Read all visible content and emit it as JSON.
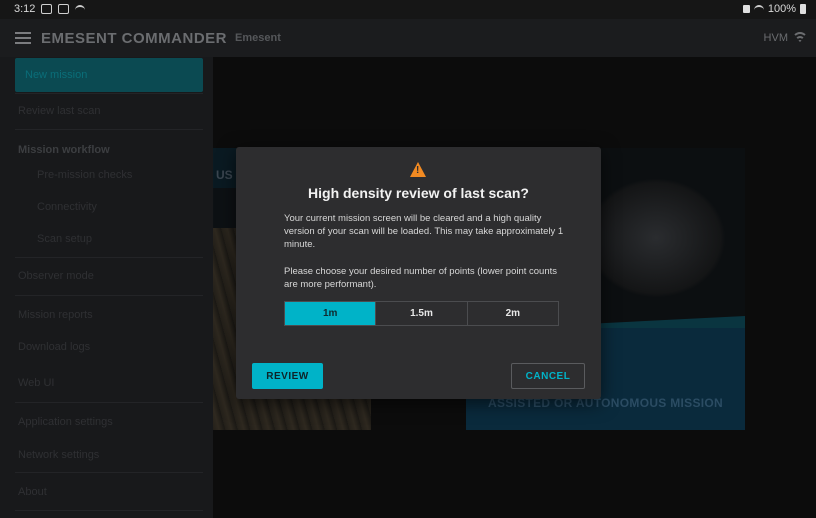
{
  "status_bar": {
    "time": "3:12",
    "battery": "100%"
  },
  "app_bar": {
    "title": "EMESENT COMMANDER",
    "subtitle": "Emesent",
    "device": "HVM"
  },
  "sidebar": {
    "items": [
      {
        "label": "New mission"
      },
      {
        "label": "Review last scan"
      },
      {
        "label": "Mission workflow"
      },
      {
        "label": "Pre-mission checks"
      },
      {
        "label": "Connectivity"
      },
      {
        "label": "Scan setup"
      },
      {
        "label": "Observer mode"
      },
      {
        "label": "Mission reports"
      },
      {
        "label": "Download logs"
      },
      {
        "label": "Web UI"
      },
      {
        "label": "Application settings"
      },
      {
        "label": "Network settings"
      },
      {
        "label": "About"
      }
    ]
  },
  "background_cards": {
    "left_title_fragment": "US",
    "right_label": "ASSISTED OR AUTONOMOUS MISSION"
  },
  "modal": {
    "icon": "warning-icon",
    "title": "High density review of last scan?",
    "body_line1": "Your current mission screen will be cleared and a high quality version of your scan will be loaded. This may take approximately 1 minute.",
    "body_line2": "Please choose your desired number of points (lower point counts are more performant).",
    "options": [
      "1m",
      "1.5m",
      "2m"
    ],
    "selected_option": "1m",
    "review_label": "REVIEW",
    "cancel_label": "CANCEL"
  },
  "colors": {
    "accent": "#00b3c8",
    "warning": "#f28a22",
    "modal_bg": "#2d2d2f"
  }
}
